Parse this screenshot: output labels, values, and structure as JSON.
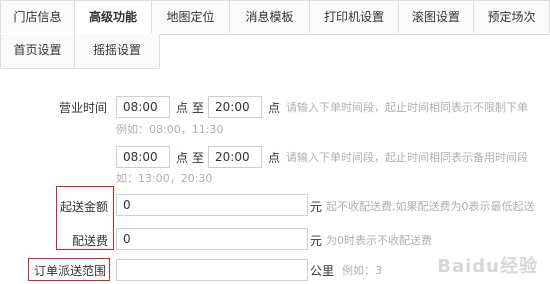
{
  "tabs_row1": [
    "门店信息",
    "高级功能",
    "地图定位",
    "消息模板",
    "打印机设置",
    "滚图设置",
    "预定场次"
  ],
  "tabs_row2": [
    "首页设置",
    "摇摇设置"
  ],
  "active_tab": "高级功能",
  "business_hours": {
    "label": "营业时间",
    "slot1": {
      "start": "08:00",
      "end": "20:00"
    },
    "slot2": {
      "start": "08:00",
      "end": "20:00"
    },
    "dian": "点",
    "zhi": "至",
    "hint1": "请输入下单时间段，起止时间相同表示不限制下单",
    "example1": "例如：08:00，11:30",
    "hint2": "请输入下单时间段，起止时间相同表示备用时间段",
    "example2": "如：13:00，20:30"
  },
  "min_delivery": {
    "label": "起送金额",
    "value": "0",
    "unit": "元",
    "hint": "起不收配送费,如果配送费为0表示最低起送"
  },
  "delivery_fee": {
    "label": "配送费",
    "value": "0",
    "unit": "元",
    "hint": "为0时表示不收配送费"
  },
  "delivery_range": {
    "label": "订单派送范围",
    "value": "",
    "unit": "公里",
    "hint": "例如：3"
  },
  "watermark": "Baidu经验",
  "colors": {
    "highlight_border": "#d9241b",
    "hint_text": "#b0b0b0",
    "tab_border": "#dcdcdc"
  }
}
